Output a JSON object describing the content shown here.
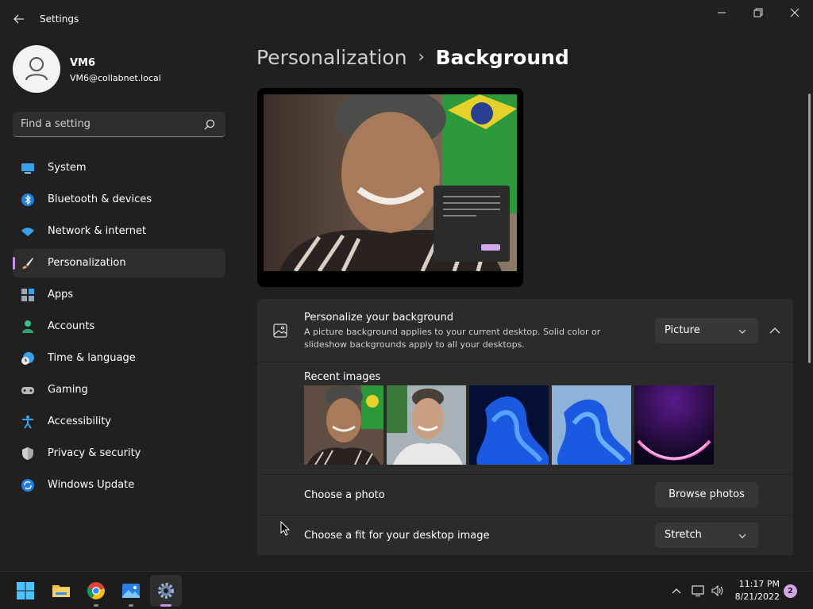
{
  "app": {
    "title": "Settings"
  },
  "profile": {
    "name": "VM6",
    "email": "VM6@collabnet.local"
  },
  "search": {
    "placeholder": "Find a setting"
  },
  "nav": {
    "items": [
      {
        "label": "System",
        "icon": "monitor-icon"
      },
      {
        "label": "Bluetooth & devices",
        "icon": "bluetooth-icon"
      },
      {
        "label": "Network & internet",
        "icon": "wifi-icon"
      },
      {
        "label": "Personalization",
        "icon": "paintbrush-icon",
        "active": true
      },
      {
        "label": "Apps",
        "icon": "apps-icon"
      },
      {
        "label": "Accounts",
        "icon": "person-icon"
      },
      {
        "label": "Time & language",
        "icon": "clock-globe-icon"
      },
      {
        "label": "Gaming",
        "icon": "gamepad-icon"
      },
      {
        "label": "Accessibility",
        "icon": "accessibility-icon"
      },
      {
        "label": "Privacy & security",
        "icon": "shield-icon"
      },
      {
        "label": "Windows Update",
        "icon": "update-icon"
      }
    ]
  },
  "breadcrumb": {
    "parent": "Personalization",
    "separator": "›",
    "current": "Background"
  },
  "background": {
    "title": "Personalize your background",
    "description": "A picture background applies to your current desktop. Solid color or slideshow backgrounds apply to all your desktops.",
    "type_value": "Picture"
  },
  "recent": {
    "label": "Recent images"
  },
  "photo": {
    "label": "Choose a photo",
    "button": "Browse photos"
  },
  "fit": {
    "label": "Choose a fit for your desktop image",
    "value": "Stretch"
  },
  "taskbar": {
    "time": "11:17 PM",
    "date": "8/21/2022",
    "notifications": "2"
  },
  "colors": {
    "accent": "#c896e6",
    "background": "#202020",
    "card": "#2b2b2b"
  }
}
